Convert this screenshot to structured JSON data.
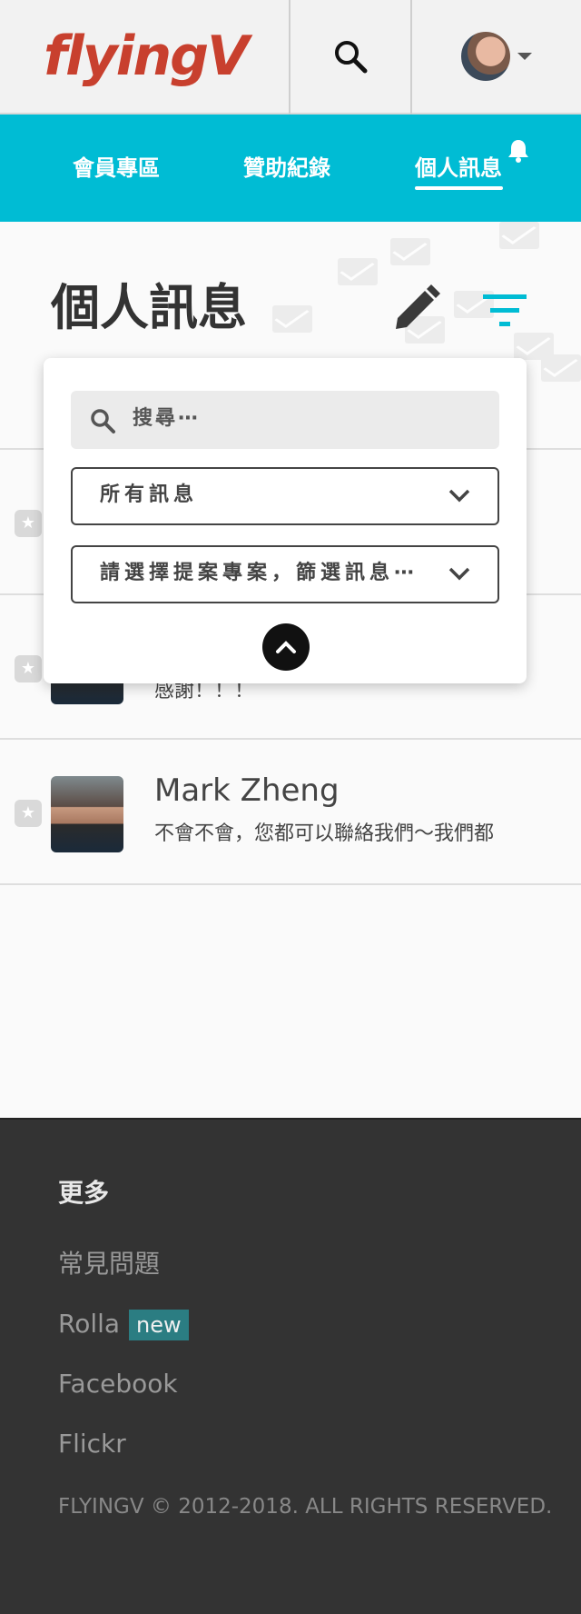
{
  "header": {
    "logo_text": "flyingV",
    "search_icon": "search-icon",
    "avatar_icon": "user-avatar",
    "dropdown_icon": "caret-down-icon"
  },
  "nav": {
    "items": [
      {
        "label": "會員專區"
      },
      {
        "label": "贊助紀錄"
      },
      {
        "label": "個人訊息",
        "active": true
      }
    ],
    "bell_icon": "bell-icon"
  },
  "page": {
    "title": "個人訊息",
    "compose_icon": "pencil-icon",
    "filter_icon": "filter-icon"
  },
  "filter_panel": {
    "search_placeholder": "搜尋⋯",
    "message_type_selected": "所有訊息",
    "project_selected": "請選擇提案專案，篩選訊息⋯",
    "collapse_icon": "chevron-up-icon"
  },
  "messages": [
    {
      "name": "",
      "preview": ""
    },
    {
      "name": "",
      "preview": "感謝！！！"
    },
    {
      "name": "Mark Zheng",
      "preview": "不會不會，您都可以聯絡我們～我們都"
    }
  ],
  "footer": {
    "title": "更多",
    "links": [
      "常見問題",
      "Rolla",
      "Facebook",
      "Flickr"
    ],
    "rolla_badge": "new",
    "copyright": "FLYINGV © 2012-2018. ALL RIGHTS RESERVED."
  },
  "colors": {
    "brand": "#c8402e",
    "nav_bg": "#00bcd4",
    "footer_bg": "#333333",
    "badge_bg": "#2b7d82"
  }
}
